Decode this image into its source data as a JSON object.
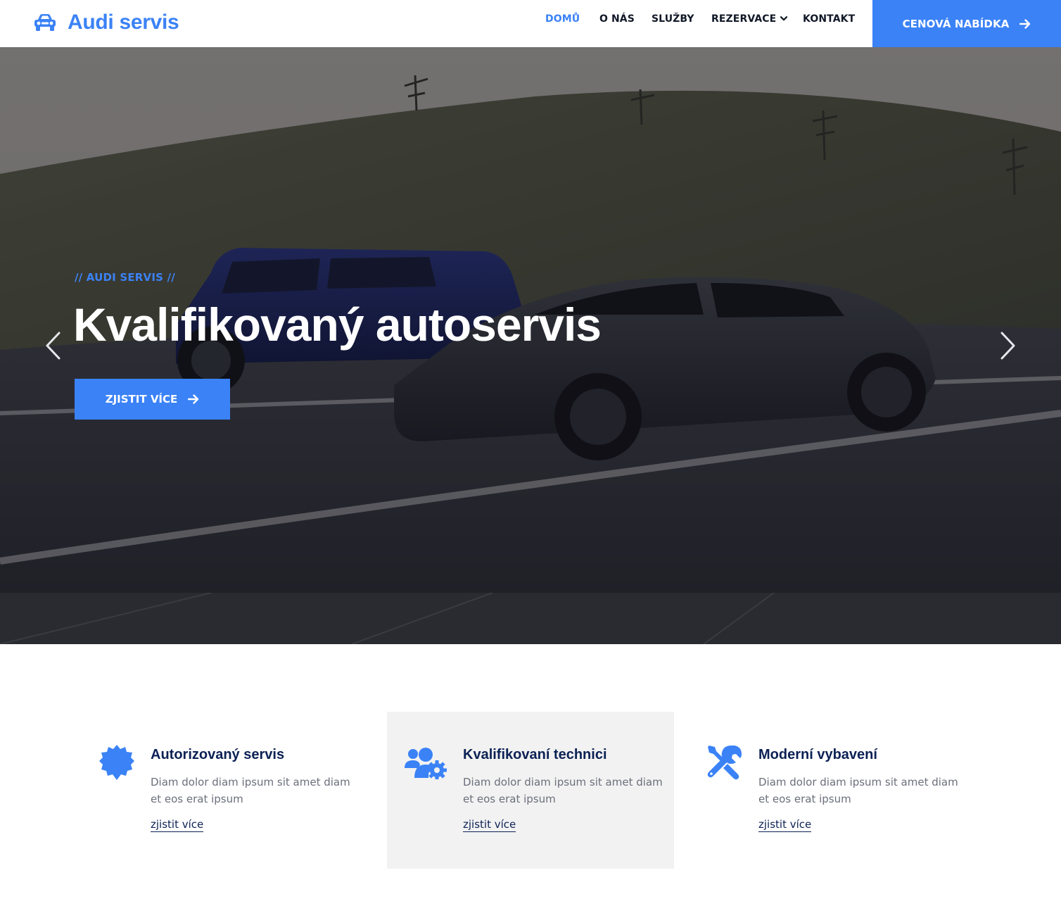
{
  "brand": {
    "name": "Audi servis",
    "icon": "car-icon",
    "color": "#3b82f6"
  },
  "nav": {
    "items": [
      {
        "label": "DOMŮ",
        "active": true
      },
      {
        "label": "O NÁS",
        "active": false
      },
      {
        "label": "SLUŽBY",
        "active": false
      },
      {
        "label": "REZERVACE",
        "active": false,
        "dropdown": true
      },
      {
        "label": "KONTAKT",
        "active": false
      }
    ],
    "cta": {
      "label": "CENOVÁ NABÍDKA",
      "icon": "arrow-right-icon"
    }
  },
  "hero": {
    "kicker": "// AUDI SERVIS //",
    "title": "Kvalifikovaný autoservis",
    "button": {
      "label": "ZJISTIT VÍCE",
      "icon": "arrow-right-icon"
    },
    "prev_icon": "chevron-left-icon",
    "next_icon": "chevron-right-icon"
  },
  "features": [
    {
      "icon": "badge-icon",
      "title": "Autorizovaný servis",
      "description": "Diam dolor diam ipsum sit amet diam et eos erat ipsum",
      "link": "zjistit více"
    },
    {
      "icon": "users-gear-icon",
      "title": "Kvalifikovaní technici",
      "description": "Diam dolor diam ipsum sit amet diam et eos erat ipsum",
      "link": "zjistit více"
    },
    {
      "icon": "tools-icon",
      "title": "Moderní vybavení",
      "description": "Diam dolor diam ipsum sit amet diam et eos erat ipsum",
      "link": "zjistit více"
    }
  ],
  "colors": {
    "primary": "#3b82f6",
    "dark": "#0b2154",
    "muted": "#6b6f7b",
    "highlight_bg": "#f2f2f2"
  }
}
